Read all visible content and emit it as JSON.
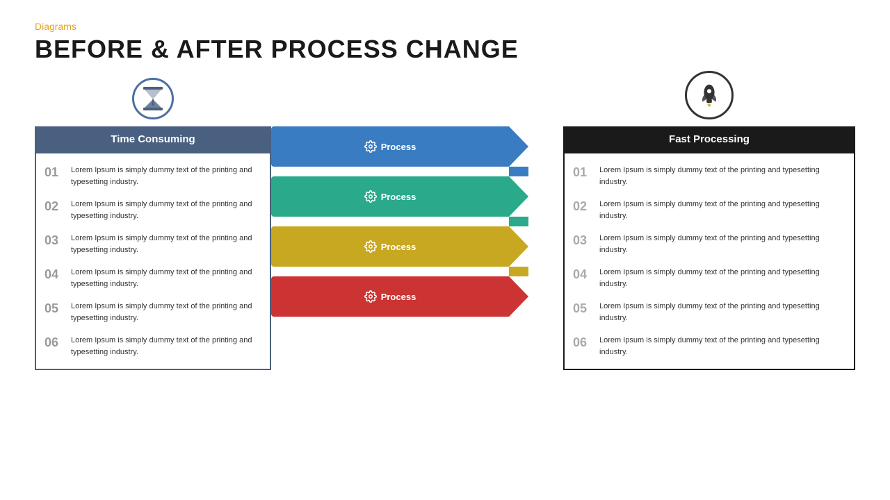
{
  "header": {
    "category": "Diagrams",
    "title": "BEFORE & AFTER PROCESS CHANGE"
  },
  "left": {
    "icon_label": "hourglass",
    "panel_title": "Time Consuming",
    "items": [
      {
        "number": "01",
        "text": "Lorem Ipsum is simply dummy text of the printing and typesetting industry."
      },
      {
        "number": "02",
        "text": "Lorem Ipsum is simply dummy text of the printing and typesetting industry."
      },
      {
        "number": "03",
        "text": "Lorem Ipsum is simply dummy text of the printing and typesetting industry."
      },
      {
        "number": "04",
        "text": "Lorem Ipsum is simply dummy text of the printing and typesetting industry."
      },
      {
        "number": "05",
        "text": "Lorem Ipsum is simply dummy text of the printing and typesetting industry."
      },
      {
        "number": "06",
        "text": "Lorem Ipsum is simply dummy text of the printing and typesetting industry."
      }
    ]
  },
  "right": {
    "icon_label": "rocket",
    "panel_title": "Fast Processing",
    "items": [
      {
        "number": "01",
        "text": "Lorem Ipsum is simply dummy text of the printing and typesetting industry."
      },
      {
        "number": "02",
        "text": "Lorem Ipsum is simply dummy text of the printing and typesetting industry."
      },
      {
        "number": "03",
        "text": "Lorem Ipsum is simply dummy text of the printing and typesetting industry."
      },
      {
        "number": "04",
        "text": "Lorem Ipsum is simply dummy text of the printing and typesetting industry."
      },
      {
        "number": "05",
        "text": "Lorem Ipsum is simply dummy text of the printing and typesetting industry."
      },
      {
        "number": "06",
        "text": "Lorem Ipsum is simply dummy text of the printing and typesetting industry."
      }
    ]
  },
  "process_arrows": [
    {
      "label": "Process",
      "color": "#3a7cc1",
      "color_name": "blue"
    },
    {
      "label": "Process",
      "color": "#2aaa8a",
      "color_name": "teal"
    },
    {
      "label": "Process",
      "color": "#c8a820",
      "color_name": "gold"
    },
    {
      "label": "Process",
      "color": "#cc3333",
      "color_name": "red"
    }
  ],
  "colors": {
    "orange": "#e8a020",
    "dark": "#1a1a1a",
    "left_header": "#4a6080",
    "right_header": "#1a1a1a"
  }
}
